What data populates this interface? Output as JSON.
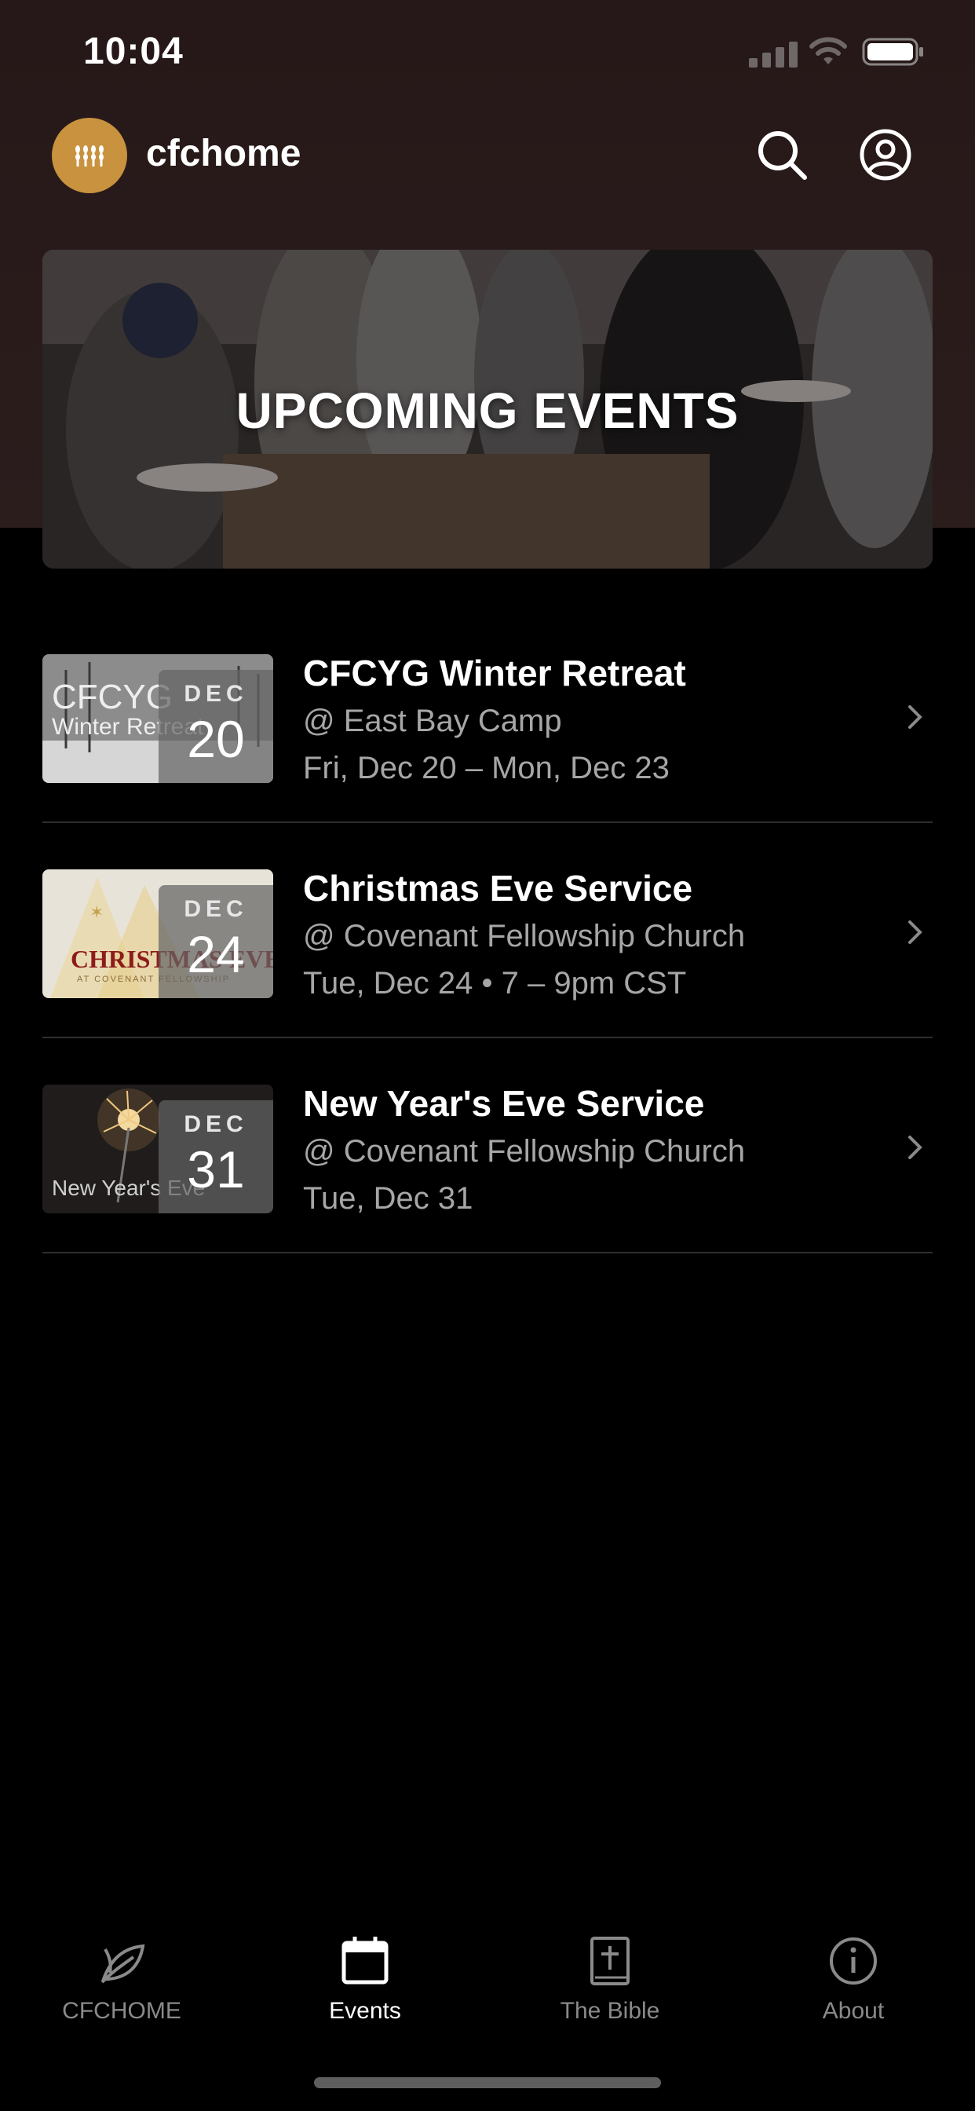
{
  "status_bar": {
    "time": "10:04"
  },
  "header": {
    "title": "cfchome",
    "logo_icon": "wheat-icon",
    "search_icon": "search-icon",
    "profile_icon": "user-circle-icon"
  },
  "banner": {
    "title": "UPCOMING EVENTS"
  },
  "events": [
    {
      "title": "CFCYG Winter Retreat",
      "location": "@ East Bay Camp",
      "datetime": "Fri, Dec 20 – Mon, Dec 23",
      "month": "DEC",
      "day": "20",
      "thumb_line1": "CFCYG",
      "thumb_line2": "Winter Retreat"
    },
    {
      "title": "Christmas Eve Service",
      "location": "@ Covenant Fellowship Church",
      "datetime": "Tue, Dec 24 • 7 – 9pm CST",
      "month": "DEC",
      "day": "24",
      "thumb_line1": "CHRISTMAS EVE",
      "thumb_line2": "AT COVENANT FELLOWSHIP"
    },
    {
      "title": "New Year's Eve Service",
      "location": "@ Covenant Fellowship Church",
      "datetime": "Tue, Dec 31",
      "month": "DEC",
      "day": "31",
      "thumb_line1": "New Year's Eve"
    }
  ],
  "tabs": [
    {
      "label": "CFCHOME",
      "icon": "leaf-icon",
      "active": false
    },
    {
      "label": "Events",
      "icon": "calendar-icon",
      "active": true
    },
    {
      "label": "The Bible",
      "icon": "bible-icon",
      "active": false
    },
    {
      "label": "About",
      "icon": "info-icon",
      "active": false
    }
  ],
  "colors": {
    "background": "#000000",
    "header_bg": "#2b1d1c",
    "accent": "#c9923f",
    "secondary_text": "#a6a6a6"
  }
}
